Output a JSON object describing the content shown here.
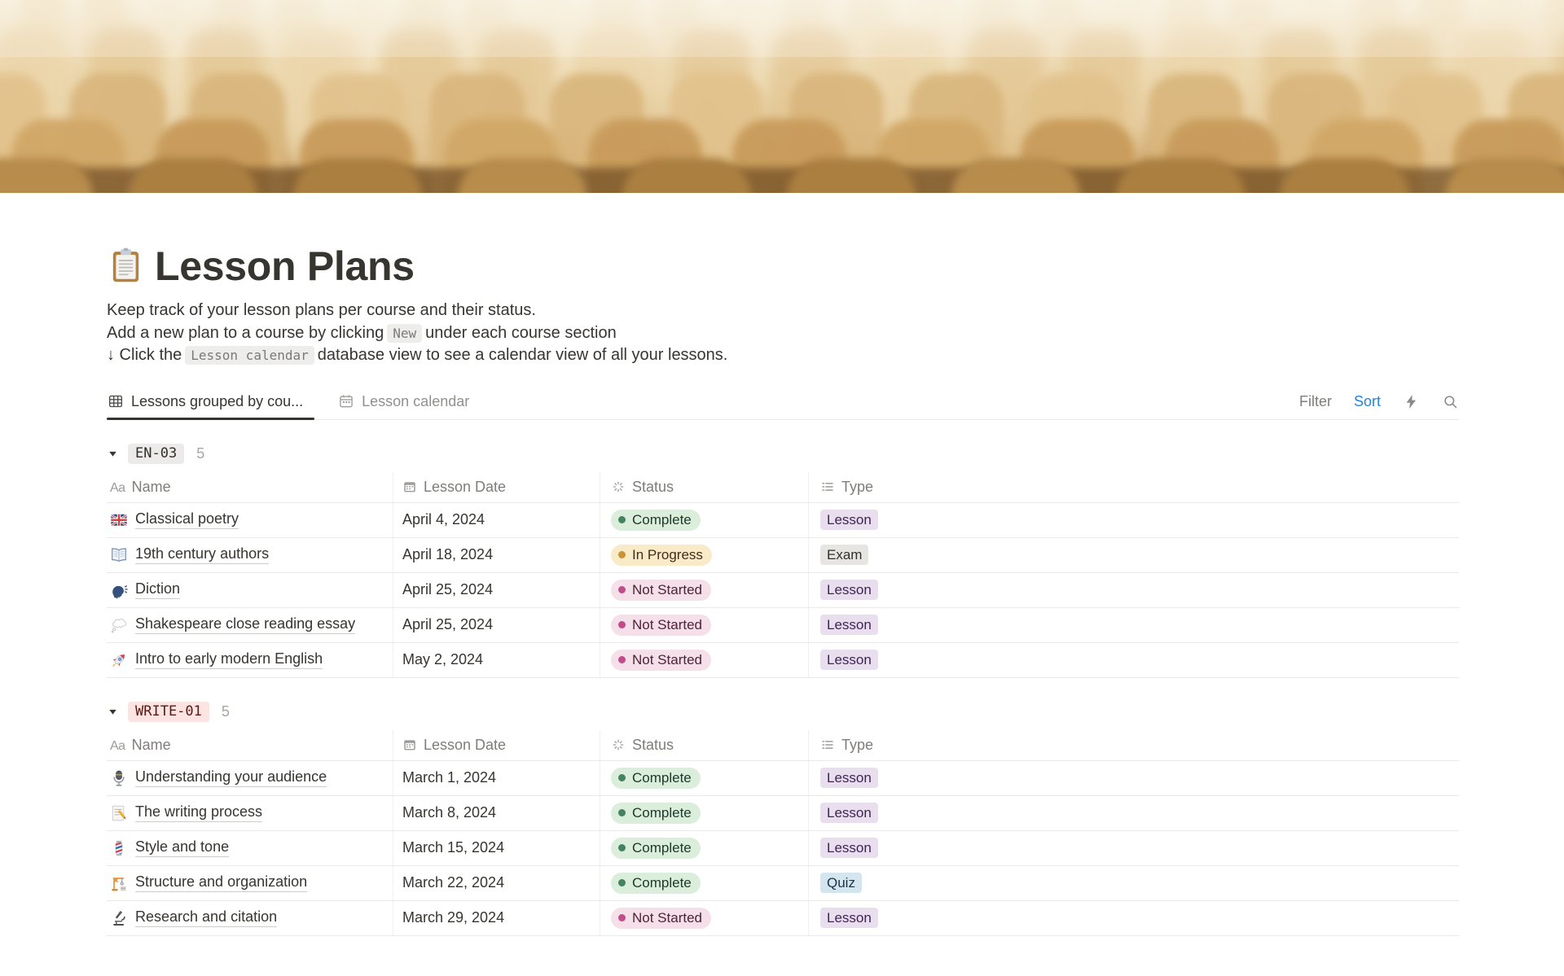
{
  "page": {
    "icon": "clipboard",
    "title": "Lesson Plans",
    "description": [
      {
        "segments": [
          {
            "text": "Keep track of your lesson plans per course and their status."
          }
        ]
      },
      {
        "segments": [
          {
            "text": "Add a new plan to a course by clicking"
          },
          {
            "code": "New"
          },
          {
            "text": "under each course section"
          }
        ]
      },
      {
        "segments": [
          {
            "text": "↓ Click the"
          },
          {
            "code": "Lesson calendar"
          },
          {
            "text": "database view to see a calendar view of all your lessons."
          }
        ]
      }
    ]
  },
  "toolbar": {
    "tabs": [
      {
        "label": "Lessons grouped by cou...",
        "icon": "table-view",
        "active": true
      },
      {
        "label": "Lesson calendar",
        "icon": "calendar-view",
        "active": false
      }
    ],
    "filter_label": "Filter",
    "sort_label": "Sort",
    "sort_color": "#2383E2"
  },
  "table": {
    "columns": [
      {
        "label": "Name",
        "icon": "text"
      },
      {
        "label": "Lesson Date",
        "icon": "calendar"
      },
      {
        "label": "Status",
        "icon": "status"
      },
      {
        "label": "Type",
        "icon": "list"
      }
    ]
  },
  "groups": [
    {
      "name": "EN-03",
      "count": "5",
      "chip_bg": "#ECEBE9",
      "chip_color": "#32302C",
      "rows": [
        {
          "icon": "flag-gb",
          "name": "Classical poetry",
          "date": "April 4, 2024",
          "status": "Complete",
          "type": "Lesson"
        },
        {
          "icon": "open-book",
          "name": "19th century authors",
          "date": "April 18, 2024",
          "status": "In Progress",
          "type": "Exam"
        },
        {
          "icon": "speaking-head",
          "name": "Diction",
          "date": "April 25, 2024",
          "status": "Not Started",
          "type": "Lesson"
        },
        {
          "icon": "thought-balloon",
          "name": "Shakespeare close reading essay",
          "date": "April 25, 2024",
          "status": "Not Started",
          "type": "Lesson"
        },
        {
          "icon": "rocket",
          "name": "Intro to early modern English",
          "date": "May 2, 2024",
          "status": "Not Started",
          "type": "Lesson"
        }
      ]
    },
    {
      "name": "WRITE-01",
      "count": "5",
      "chip_bg": "#FBE4E1",
      "chip_color": "#5D1715",
      "rows": [
        {
          "icon": "microphone",
          "name": "Understanding your audience",
          "date": "March 1, 2024",
          "status": "Complete",
          "type": "Lesson"
        },
        {
          "icon": "memo",
          "name": "The writing process",
          "date": "March 8, 2024",
          "status": "Complete",
          "type": "Lesson"
        },
        {
          "icon": "barber-pole",
          "name": "Style and tone",
          "date": "March 15, 2024",
          "status": "Complete",
          "type": "Lesson"
        },
        {
          "icon": "building-construction",
          "name": "Structure and organization",
          "date": "March 22, 2024",
          "status": "Complete",
          "type": "Quiz"
        },
        {
          "icon": "microscope",
          "name": "Research and citation",
          "date": "March 29, 2024",
          "status": "Not Started",
          "type": "Lesson"
        }
      ]
    }
  ],
  "status_styles": {
    "Complete": {
      "bg": "#DBEDDB",
      "dot": "#448361",
      "text": "#1C3829"
    },
    "In Progress": {
      "bg": "#FAEBC8",
      "dot": "#C99435",
      "text": "#402C1B"
    },
    "Not Started": {
      "bg": "#F5E0E9",
      "dot": "#C14C8A",
      "text": "#4C2337"
    }
  },
  "type_styles": {
    "Lesson": {
      "bg": "#E8DEEE",
      "text": "#412454"
    },
    "Exam": {
      "bg": "#E6E5E2",
      "text": "#32302C"
    },
    "Quiz": {
      "bg": "#D3E5EF",
      "text": "#183347"
    }
  }
}
